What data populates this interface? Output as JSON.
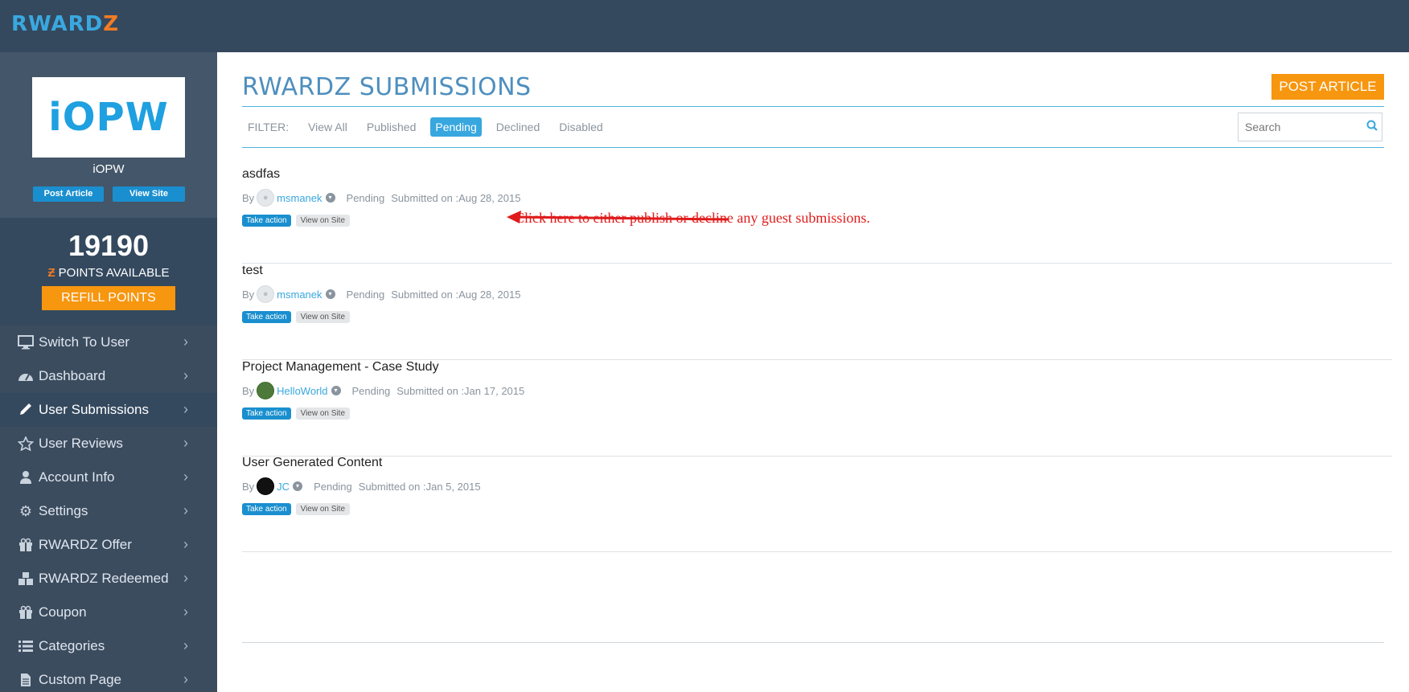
{
  "header": {
    "logo_text": "RWARD",
    "logo_z": "Z"
  },
  "profile": {
    "logo_text": "iOPW",
    "name": "iOPW",
    "post_article_label": "Post Article",
    "view_site_label": "View Site"
  },
  "points": {
    "value": "19190",
    "label": "POINTS AVAILABLE",
    "refill_label": "REFILL POINTS"
  },
  "nav": {
    "items": [
      {
        "label": "Switch To User",
        "icon": "monitor-icon"
      },
      {
        "label": "Dashboard",
        "icon": "dashboard-icon"
      },
      {
        "label": "User Submissions",
        "icon": "pencil-icon"
      },
      {
        "label": "User Reviews",
        "icon": "star-icon"
      },
      {
        "label": "Account Info",
        "icon": "user-icon"
      },
      {
        "label": "Settings",
        "icon": "gear-icon"
      },
      {
        "label": "RWARDZ Offer",
        "icon": "gift-icon"
      },
      {
        "label": "RWARDZ Redeemed",
        "icon": "cubes-icon"
      },
      {
        "label": "Coupon",
        "icon": "gift-icon"
      },
      {
        "label": "Categories",
        "icon": "list-icon"
      },
      {
        "label": "Custom Page",
        "icon": "file-icon"
      }
    ]
  },
  "main": {
    "title": "RWARDZ SUBMISSIONS",
    "post_article_label": "POST ARTICLE",
    "filter": {
      "label": "FILTER:",
      "items": [
        "View All",
        "Published",
        "Pending",
        "Declined",
        "Disabled"
      ],
      "active": "Pending"
    },
    "search": {
      "placeholder": "Search"
    }
  },
  "submissions": [
    {
      "title": "asdfas",
      "by": "By",
      "author": "msmanek",
      "status": "Pending",
      "submitted": "Submitted on :Aug 28, 2015",
      "take_action": "Take action",
      "view_on_site": "View on Site"
    },
    {
      "title": "test",
      "by": "By",
      "author": "msmanek",
      "status": "Pending",
      "submitted": "Submitted on :Aug 28, 2015",
      "take_action": "Take action",
      "view_on_site": "View on Site"
    },
    {
      "title": "Project Management - Case Study",
      "by": "By",
      "author": "HelloWorld",
      "status": "Pending",
      "submitted": "Submitted on :Jan 17, 2015",
      "take_action": "Take action",
      "view_on_site": "View on Site"
    },
    {
      "title": "User Generated Content",
      "by": "By",
      "author": "JC",
      "status": "Pending",
      "submitted": "Submitted on :Jan 5, 2015",
      "take_action": "Take action",
      "view_on_site": "View on Site"
    }
  ],
  "annotation": {
    "text": "Click here to either publish or decline any guest submissions.",
    "color": "#e01b1b"
  },
  "colors": {
    "topbar": "#34495e",
    "sidebar": "#3c4c5f",
    "accent_orange": "#f7960f",
    "accent_blue": "#38a7df",
    "title_blue": "#4e8fbe"
  }
}
